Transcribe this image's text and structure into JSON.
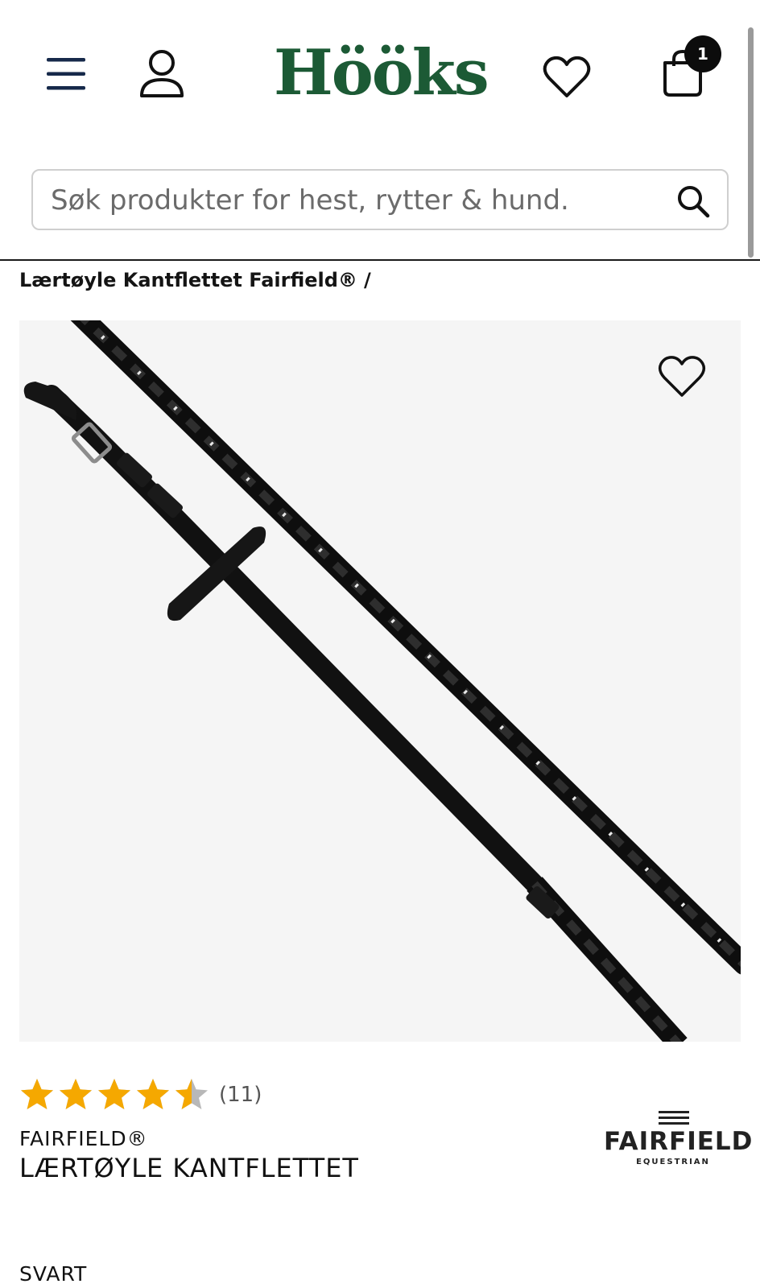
{
  "header": {
    "logo_text": "Hööks",
    "cart_count": "1",
    "brand_color": "#1c5a35"
  },
  "search": {
    "placeholder": "Søk produkter for hest, rytter & hund."
  },
  "breadcrumb": {
    "current": "Lærtøyle Kantflettet Fairfield®",
    "separator": "/"
  },
  "product": {
    "rating": 4.5,
    "rating_max": 5,
    "review_count": "(11)",
    "brand": "FAIRFIELD®",
    "title": "LÆRTØYLE KANTFLETTET",
    "color": "SVART",
    "star_color": "#f5a800",
    "star_empty_color": "#b8b8b8"
  },
  "brand_logo": {
    "word": "FAIRFIELD",
    "sub": "EQUESTRIAN"
  },
  "icons": [
    "menu-icon",
    "user-icon",
    "heart-icon",
    "shopping-bag-icon",
    "search-icon",
    "star-icon"
  ]
}
